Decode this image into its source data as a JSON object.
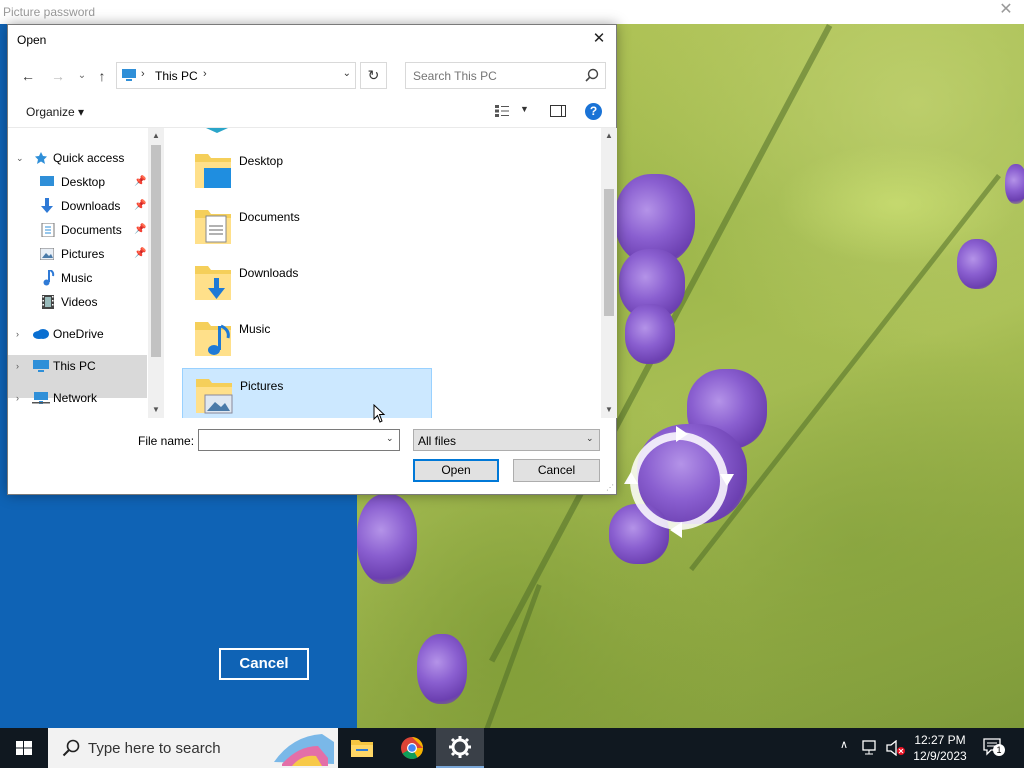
{
  "app": {
    "title": "Picture password",
    "close_glyph": "✕",
    "cancel_label": "Cancel"
  },
  "dialog": {
    "title": "Open",
    "close_glyph": "✕",
    "nav": {
      "back_glyph": "←",
      "forward_glyph": "→",
      "recent_glyph": "⌄",
      "up_glyph": "↑",
      "refresh_glyph": "↻"
    },
    "address": {
      "path": "This PC",
      "sep": "›"
    },
    "search": {
      "placeholder": "Search This PC"
    },
    "toolbar": {
      "organize_label": "Organize ▾",
      "help_label": "?"
    },
    "navigation": [
      {
        "label": "Quick access",
        "icon": "star-icon",
        "pinned": false
      },
      {
        "label": "Desktop",
        "icon": "desktop-icon",
        "pinned": true
      },
      {
        "label": "Downloads",
        "icon": "download-icon",
        "pinned": true
      },
      {
        "label": "Documents",
        "icon": "document-icon",
        "pinned": true
      },
      {
        "label": "Pictures",
        "icon": "picture-icon",
        "pinned": true
      },
      {
        "label": "Music",
        "icon": "music-icon",
        "pinned": false
      },
      {
        "label": "Videos",
        "icon": "video-icon",
        "pinned": false
      },
      {
        "label": "OneDrive",
        "icon": "cloud-icon",
        "pinned": false
      },
      {
        "label": "This PC",
        "icon": "computer-icon",
        "pinned": false,
        "selected": true
      },
      {
        "label": "Network",
        "icon": "network-icon",
        "pinned": false
      }
    ],
    "files": [
      {
        "label": "Desktop",
        "icon": "desktop-folder-icon"
      },
      {
        "label": "Documents",
        "icon": "documents-folder-icon"
      },
      {
        "label": "Downloads",
        "icon": "downloads-folder-icon"
      },
      {
        "label": "Music",
        "icon": "music-folder-icon"
      },
      {
        "label": "Pictures",
        "icon": "pictures-folder-icon",
        "selected": true
      }
    ],
    "file_name_label": "File name:",
    "file_name_value": "",
    "file_type": "All files",
    "open_label": "Open",
    "cancel_label": "Cancel"
  },
  "taskbar": {
    "search_placeholder": "Type here to search",
    "time": "12:27 PM",
    "date": "12/9/2023",
    "notification_count": "1"
  },
  "colors": {
    "accent": "#0078d7",
    "left_panel": "#0f63b5",
    "selection": "#cce8ff",
    "taskbar": "#101820"
  }
}
